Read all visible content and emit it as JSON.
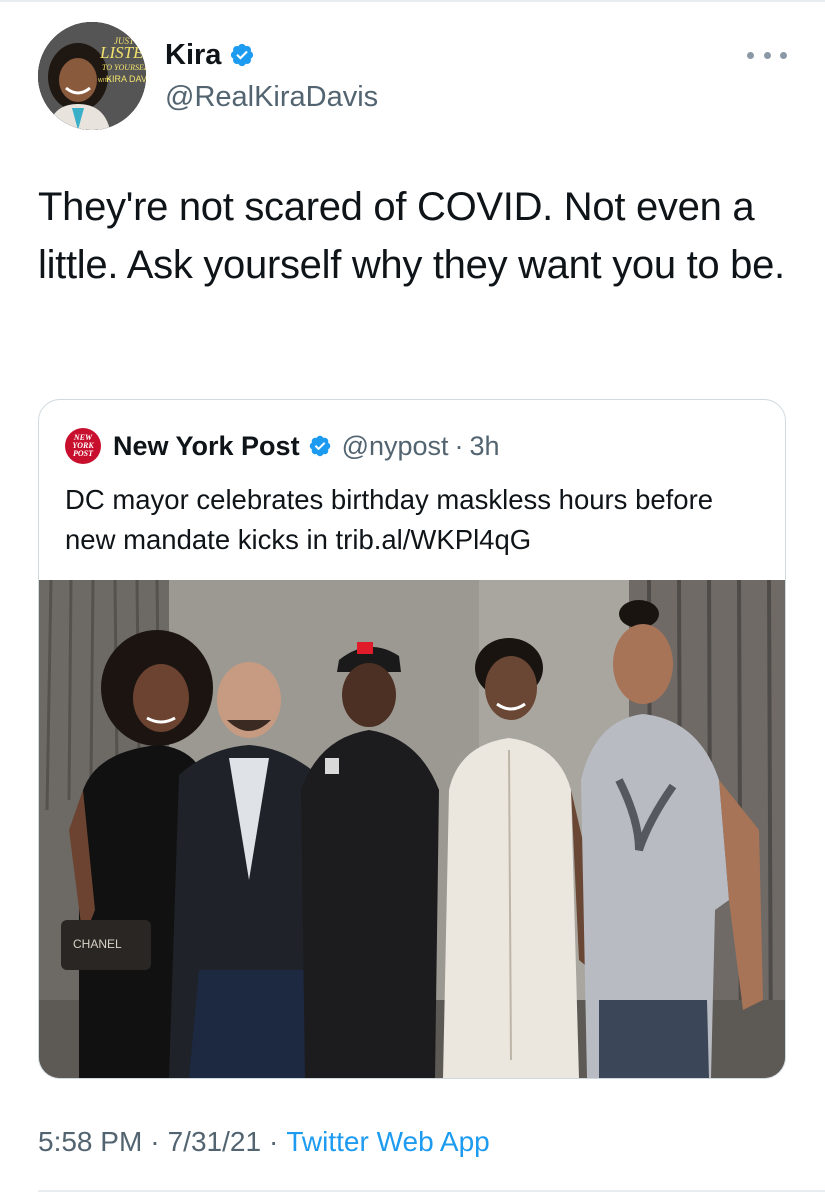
{
  "author": {
    "display_name": "Kira",
    "handle": "@RealKiraDavis",
    "verified": true,
    "avatar": {
      "lines": [
        "JUST",
        "LISTEN",
        "TO YOURSELF",
        "WITH",
        "KIRA DAVIS"
      ]
    }
  },
  "tweet": {
    "text": "They're not scared of COVID. Not even a little. Ask yourself why they want you to be."
  },
  "quoted_tweet": {
    "logo_text": [
      "NEW",
      "YORK",
      "POST"
    ],
    "name": "New York Post",
    "verified": true,
    "handle": "@nypost",
    "separator": "·",
    "time": "3h",
    "text": "DC mayor celebrates birthday maskless hours before new mandate kicks in trib.al/WKPl4qG",
    "photo": {
      "bag_text": "CHANEL"
    }
  },
  "meta": {
    "time": "5:58 PM",
    "sep1": "·",
    "date": "7/31/21",
    "sep2": "·",
    "source": "Twitter Web App"
  },
  "colors": {
    "accent": "#1d9bf0",
    "secondary_text": "#536471",
    "nypost_red": "#c8102e"
  },
  "icons": [
    "verified-badge-icon",
    "more-options-icon"
  ]
}
